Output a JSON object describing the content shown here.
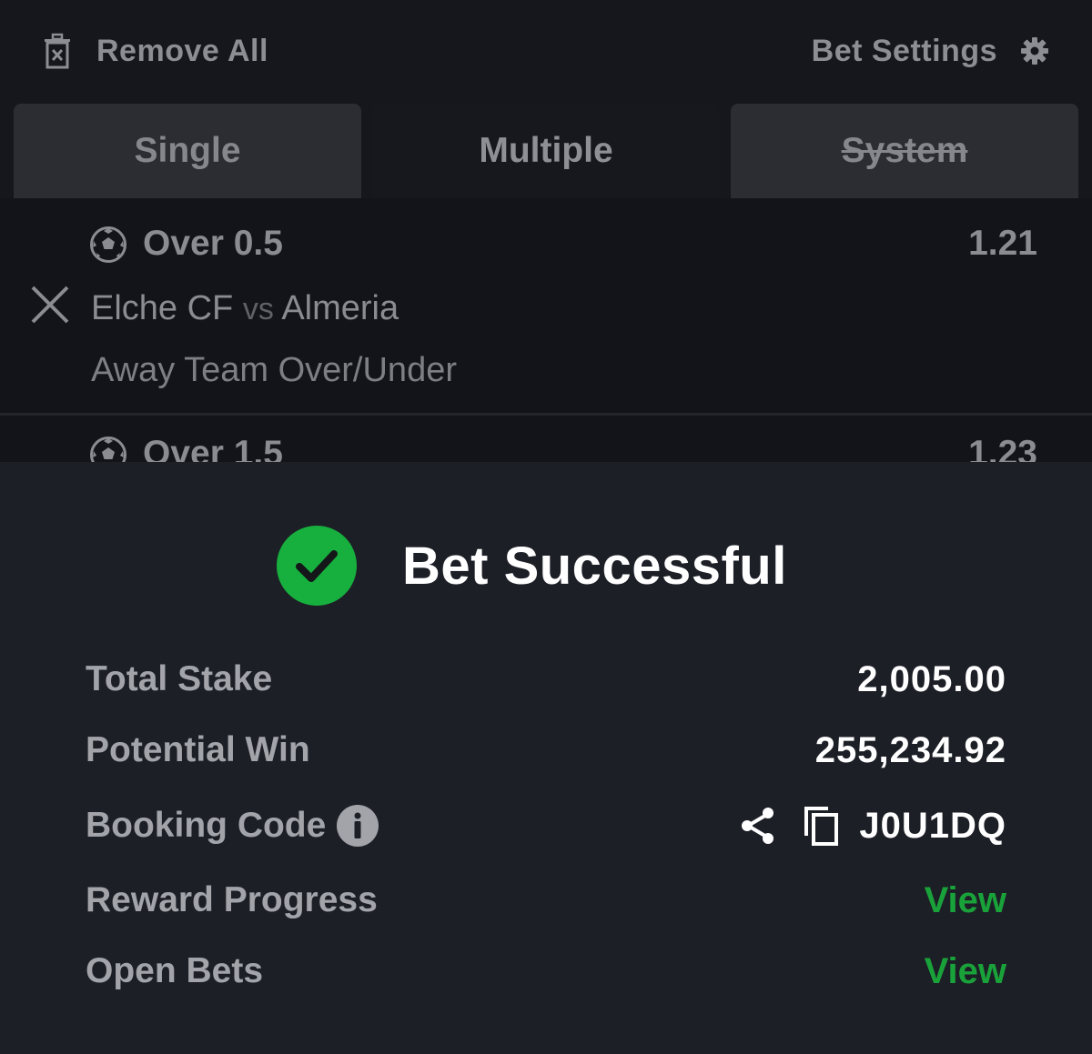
{
  "header": {
    "remove_all_label": "Remove All",
    "bet_settings_label": "Bet Settings"
  },
  "tabs": [
    {
      "label": "Single",
      "state": "inactive"
    },
    {
      "label": "Multiple",
      "state": "active"
    },
    {
      "label": "System",
      "state": "disabled"
    }
  ],
  "selections": [
    {
      "pick": "Over 0.5",
      "odds": "1.21",
      "home": "Elche CF",
      "vs": "vs",
      "away": "Almeria",
      "market": "Away Team Over/Under",
      "icon": "soccer-ball-icon"
    },
    {
      "pick": "Over 1.5",
      "odds": "1.23",
      "icon": "soccer-ball-icon"
    }
  ],
  "result": {
    "title": "Bet Successful",
    "total_stake_label": "Total Stake",
    "total_stake_value": "2,005.00",
    "potential_win_label": "Potential Win",
    "potential_win_value": "255,234.92",
    "booking_code_label": "Booking Code",
    "booking_code_value": "J0U1DQ",
    "reward_progress_label": "Reward Progress",
    "reward_progress_link": "View",
    "open_bets_label": "Open Bets",
    "open_bets_link": "View"
  },
  "colors": {
    "background": "#15171c",
    "sheet": "#1c1f26",
    "success_green": "#17b03e",
    "link_green": "#1aa23a"
  }
}
